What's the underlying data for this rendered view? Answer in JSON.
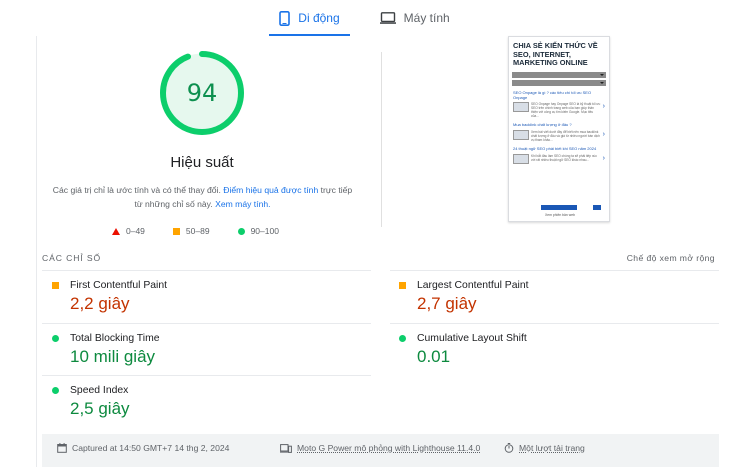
{
  "tabs": [
    {
      "label": "Di động",
      "icon": "phone-icon",
      "active": true
    },
    {
      "label": "Máy tính",
      "icon": "desktop-icon",
      "active": false
    }
  ],
  "gauge": {
    "score": "94",
    "score_fraction": 0.94,
    "title": "Hiệu suất",
    "desc_before": "Các giá trị chỉ là ước tính và có thể thay đổi. ",
    "desc_link1": "Điểm hiệu quả được tính",
    "desc_middle": " trực tiếp từ những chỉ số này. ",
    "desc_link2": "Xem máy tính.",
    "color": "#0cce6b"
  },
  "legend": [
    {
      "label": "0–49",
      "shape": "triangle",
      "color": "#eb0f00"
    },
    {
      "label": "50–89",
      "shape": "square",
      "color": "#ffa400"
    },
    {
      "label": "90–100",
      "shape": "circle",
      "color": "#0cce6b"
    }
  ],
  "thumbnail": {
    "site_title": "CHIA SẺ KIẾN THỨC VỀ SEO, INTERNET, MARKETING ONLINE",
    "bar1": "Trang chủ",
    "bar2": "Trang chủ",
    "posts": [
      {
        "title": "SEO Onpage là gì ? các tiêu chí tối ưu SEO Onpage",
        "text": "SEO Onpage hay Onpage SEO là kỹ thuật tối ưu SEO trên chính trang web của bạn giúp thân thiện với công cụ tìm kiếm Google. Mục tiêu của..."
      },
      {
        "title": "Mua backlink chất lượng ở đâu ?",
        "text": "Xem bài viết dưới đây để biết nên mua backlink chất lượng ở đâu và giá từ nhiều người bán dịch vụ tham khảo..."
      },
      {
        "title": "24 thuật ngữ SEO phải biết khi SEO năm 2024",
        "text": "Khi bắt đầu làm SEO chúng ta sẽ phải tiếp xúc với rất nhiều thuật ngữ SEO khác nhau..."
      }
    ],
    "footer_link": "Xem phiên bản web"
  },
  "metrics": {
    "header": "CÁC CHỈ SỐ",
    "toggle": "Chế độ xem mở rộng",
    "items": [
      {
        "label": "First Contentful Paint",
        "value": "2,2 giây",
        "status": "average"
      },
      {
        "label": "Largest Contentful Paint",
        "value": "2,7 giây",
        "status": "average"
      },
      {
        "label": "Total Blocking Time",
        "value": "10 mili giây",
        "status": "pass"
      },
      {
        "label": "Cumulative Layout Shift",
        "value": "0.01",
        "status": "pass"
      },
      {
        "label": "Speed Index",
        "value": "2,5 giây",
        "status": "pass"
      }
    ]
  },
  "footer": {
    "captured": "Captured at 14:50 GMT+7 14 thg 2, 2024",
    "device": "Moto G Power mô phỏng with Lighthouse 11.4.0",
    "load": "Một lượt tải trang"
  },
  "colors": {
    "accent": "#1a73e8",
    "pass": "#0cce6b",
    "average": "#ffa400",
    "fail": "#eb0f00"
  }
}
